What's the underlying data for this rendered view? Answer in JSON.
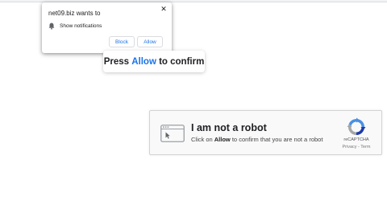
{
  "notification_popup": {
    "title": "net09.biz wants to",
    "close_symbol": "✕",
    "permission_icon": "bell-icon",
    "permission_label": "Show notifications",
    "block_label": "Block",
    "allow_label": "Allow"
  },
  "instruction": {
    "prefix": "Press ",
    "highlight": "Allow",
    "suffix": " to confirm",
    "highlight_color": "#1a73e8"
  },
  "captcha": {
    "icon": "browser-window-icon",
    "title": "I am not a robot",
    "sub_prefix": "Click on ",
    "sub_bold": "Allow",
    "sub_suffix": " to confirm that you are not a robot",
    "logo_icon": "recaptcha-logo-icon",
    "brand_label": "reCAPTCHA",
    "privacy_link": "Privacy",
    "separator": " - ",
    "terms_link": "Term"
  },
  "colors": {
    "accent": "#1a73e8",
    "captcha_background": "#f9f9f9",
    "captcha_border": "#d3d3d3"
  }
}
